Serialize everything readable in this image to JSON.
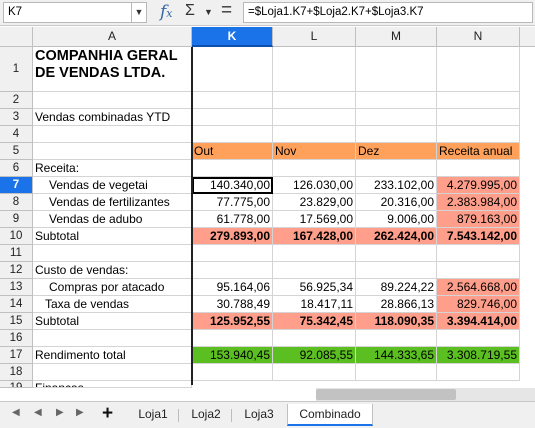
{
  "formula_bar": {
    "name_box": "K7",
    "name_box_icon": "chevron-down-icon",
    "function_wizard_icon": "fx-icon",
    "sum_icon": "sigma-icon",
    "formula_icon": "equals-icon",
    "formula": "=$Loja1.K7+$Loja2.K7+$Loja3.K7"
  },
  "columns": [
    "A",
    "K",
    "L",
    "M",
    "N"
  ],
  "selected_column": "K",
  "rows": [
    "1",
    "2",
    "3",
    "4",
    "5",
    "6",
    "7",
    "8",
    "9",
    "10",
    "11",
    "12",
    "13",
    "14",
    "15",
    "16",
    "17",
    "18",
    "19"
  ],
  "selected_row": "7",
  "sheet": {
    "title": "COMPANHIA GERAL DE VENDAS LTDA.",
    "subtitle": "Vendas combinadas YTD",
    "headers": [
      "Out",
      "Nov",
      "Dez",
      "Receita anual"
    ],
    "revenue_label": "Receita:",
    "revenue_rows": [
      {
        "label": "Vendas de vegetai",
        "values": [
          "140.340,00",
          "126.030,00",
          "233.102,00",
          "4.279.995,00"
        ]
      },
      {
        "label": "Vendas de fertilizantes",
        "values": [
          "77.775,00",
          "23.829,00",
          "20.316,00",
          "2.383.984,00"
        ]
      },
      {
        "label": "Vendas de adubo",
        "values": [
          "61.778,00",
          "17.569,00",
          "9.006,00",
          "879.163,00"
        ]
      }
    ],
    "revenue_subtotal": {
      "label": "Subtotal",
      "values": [
        "279.893,00",
        "167.428,00",
        "262.424,00",
        "7.543.142,00"
      ]
    },
    "cost_label": "Custo de vendas:",
    "cost_rows": [
      {
        "label": "Compras por atacado",
        "values": [
          "95.164,06",
          "56.925,34",
          "89.224,22",
          "2.564.668,00"
        ]
      },
      {
        "label": "Taxa de vendas",
        "values": [
          "30.788,49",
          "18.417,11",
          "28.866,13",
          "829.746,00"
        ]
      }
    ],
    "cost_subtotal": {
      "label": "Subtotal",
      "values": [
        "125.952,55",
        "75.342,45",
        "118.090,35",
        "3.394.414,00"
      ]
    },
    "total": {
      "label": "Rendimento total",
      "values": [
        "153.940,45",
        "92.085,55",
        "144.333,65",
        "3.308.719,55"
      ]
    },
    "row19_label": "Finanças"
  },
  "colors": {
    "header_fill": "#ffa15a",
    "subtotal_fill": "#ff9e8a",
    "total_fill": "#5bbf21",
    "selection": "#1a73e8"
  },
  "tabs": [
    "Loja1",
    "Loja2",
    "Loja3",
    "Combinado"
  ],
  "active_tab": "Combinado",
  "tab_nav_icons": [
    "first-sheet-icon",
    "previous-sheet-icon",
    "next-sheet-icon",
    "last-sheet-icon"
  ],
  "add_sheet_icon": "plus-icon"
}
